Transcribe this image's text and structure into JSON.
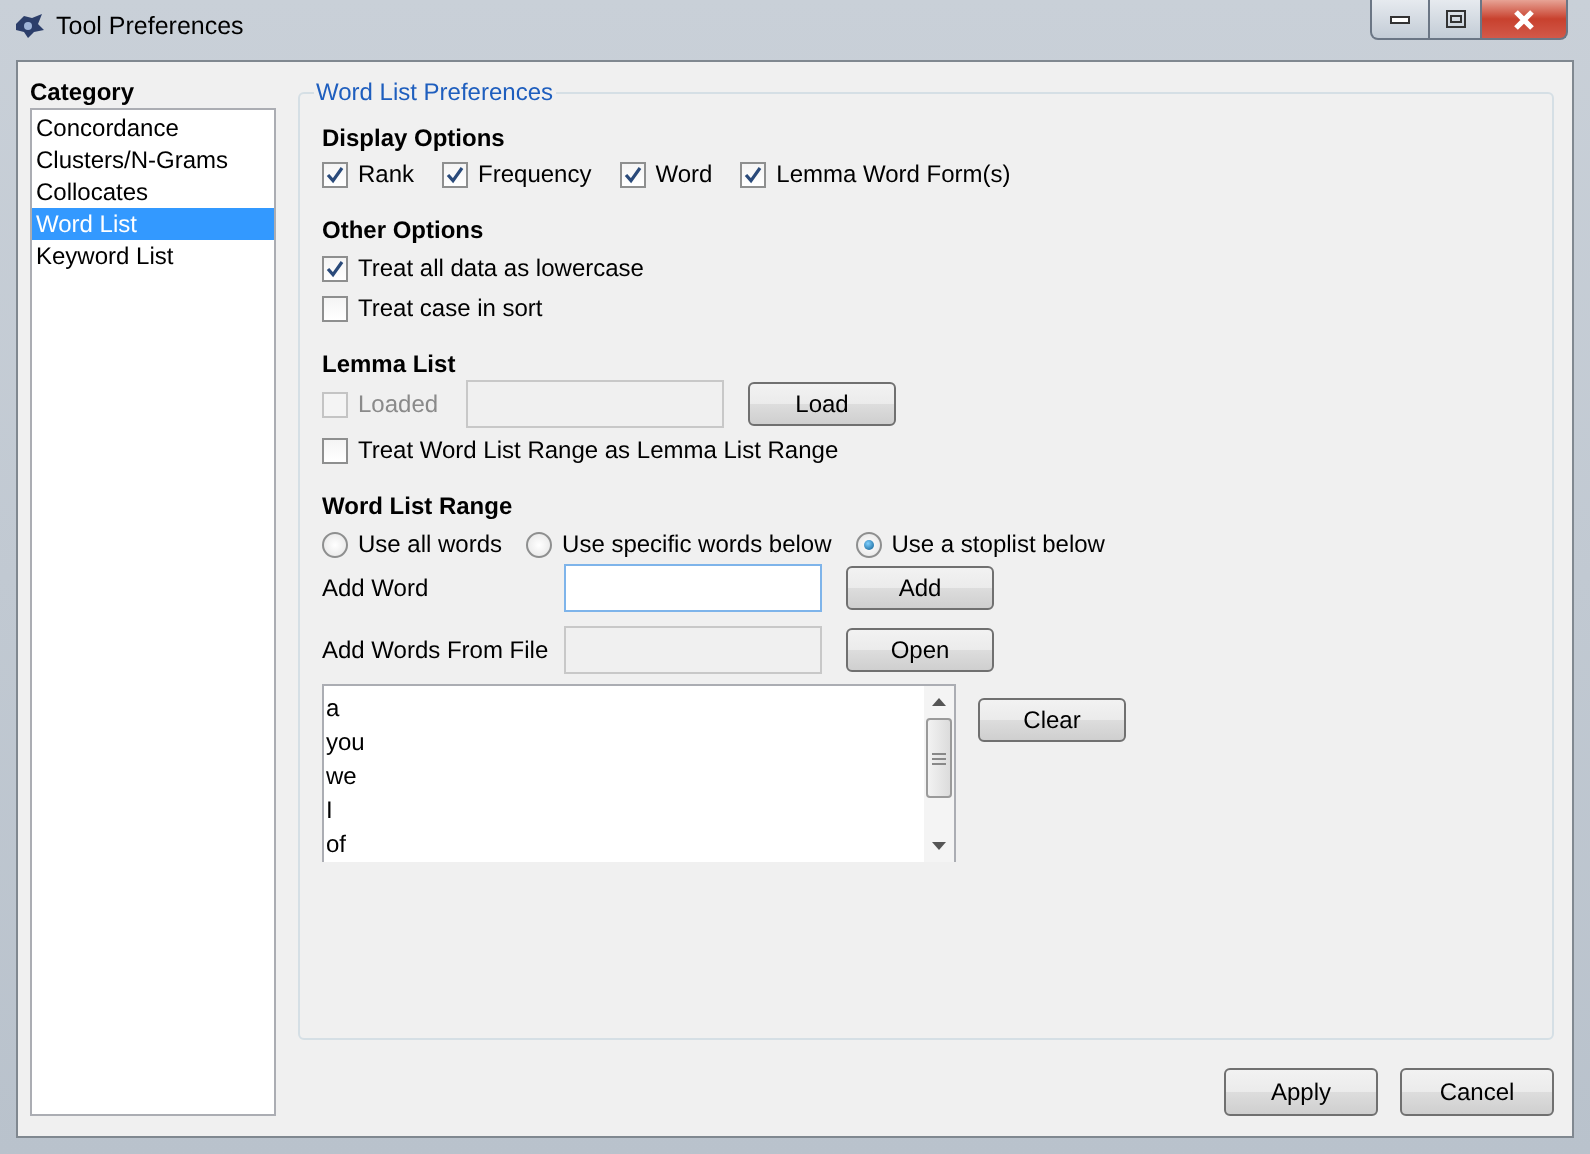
{
  "window": {
    "title": "Tool Preferences"
  },
  "category": {
    "label": "Category",
    "items": [
      {
        "label": "Concordance",
        "selected": false
      },
      {
        "label": "Clusters/N-Grams",
        "selected": false
      },
      {
        "label": "Collocates",
        "selected": false
      },
      {
        "label": "Word List",
        "selected": true
      },
      {
        "label": "Keyword List",
        "selected": false
      }
    ]
  },
  "panel": {
    "title": "Word List Preferences",
    "display_options": {
      "heading": "Display Options",
      "options": [
        {
          "label": "Rank",
          "checked": true
        },
        {
          "label": "Frequency",
          "checked": true
        },
        {
          "label": "Word",
          "checked": true
        },
        {
          "label": "Lemma Word Form(s)",
          "checked": true
        }
      ]
    },
    "other_options": {
      "heading": "Other Options",
      "options": [
        {
          "label": "Treat all data as lowercase",
          "checked": true
        },
        {
          "label": "Treat case in sort",
          "checked": false
        }
      ]
    },
    "lemma_list": {
      "heading": "Lemma List",
      "loaded": {
        "label": "Loaded",
        "checked": false,
        "disabled": true
      },
      "field": {
        "disabled": true
      },
      "load_button": "Load",
      "treat_range": {
        "label": "Treat Word List Range as Lemma List Range",
        "checked": false
      }
    },
    "word_list_range": {
      "heading": "Word List Range",
      "modes": [
        {
          "label": "Use all words",
          "selected": false
        },
        {
          "label": "Use specific words below",
          "selected": false
        },
        {
          "label": "Use a stoplist below",
          "selected": true
        }
      ],
      "add_word": {
        "label": "Add Word",
        "disabled": false,
        "button": "Add"
      },
      "add_file": {
        "label": "Add Words From File",
        "disabled": true,
        "button": "Open"
      },
      "words": [
        "a",
        "you",
        "we",
        "I",
        "of"
      ],
      "clear_button": "Clear"
    }
  },
  "buttons": [
    "Apply",
    "Cancel"
  ]
}
